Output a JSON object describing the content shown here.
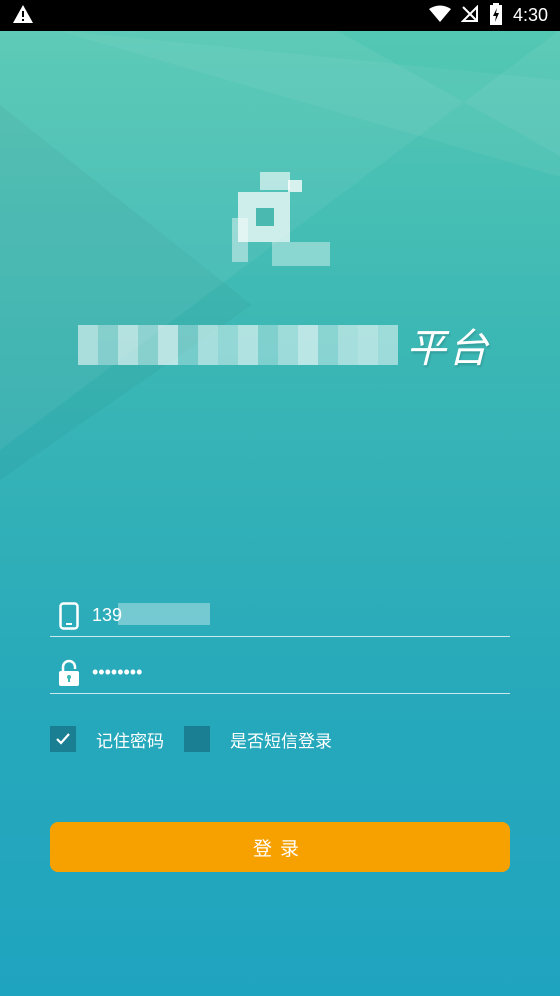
{
  "status_bar": {
    "time": "4:30",
    "icons": [
      "warning-icon",
      "wifi-icon",
      "no-signal-icon",
      "battery-charging-icon"
    ]
  },
  "app": {
    "logo_icon": "app-logo-icon",
    "title_suffix": "平台"
  },
  "form": {
    "phone_value": "139",
    "password_value": "••••••••",
    "phone_icon": "phone-icon",
    "lock_icon": "lock-icon"
  },
  "options": {
    "remember_password": {
      "label": "记住密码",
      "checked": true
    },
    "sms_login": {
      "label": "是否短信登录",
      "checked": false
    }
  },
  "login_button": {
    "label": "登录"
  },
  "colors": {
    "accent": "#f7a100",
    "checkbox": "#1a7f93",
    "gradient_top": "#56c9b3",
    "gradient_bottom": "#1fa4c0"
  }
}
